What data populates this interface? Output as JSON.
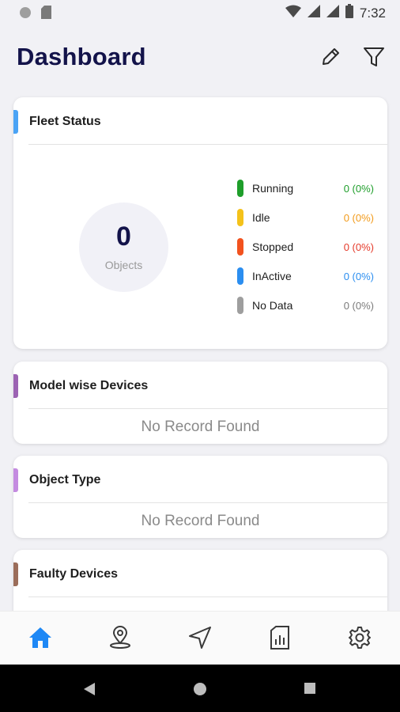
{
  "status_bar": {
    "time": "7:32",
    "icons": [
      "circle-icon",
      "sd-card-icon",
      "wifi-icon",
      "signal-icon",
      "signal-icon",
      "battery-icon"
    ]
  },
  "header": {
    "title": "Dashboard",
    "edit_icon": "pencil-icon",
    "filter_icon": "filter-icon"
  },
  "fleet_status": {
    "title": "Fleet Status",
    "accent": "#4aa3f5",
    "total_count": "0",
    "total_label": "Objects",
    "legend": [
      {
        "label": "Running",
        "value": "0 (0%)",
        "color": "#1e9e2a"
      },
      {
        "label": "Idle",
        "value": "0 (0%)",
        "color": "#f4c21a"
      },
      {
        "label": "Stopped",
        "value": "0 (0%)",
        "color": "#f2521e"
      },
      {
        "label": "InActive",
        "value": "0 (0%)",
        "color": "#2b8ef0"
      },
      {
        "label": "No Data",
        "value": "0 (0%)",
        "color": "#9e9e9e"
      }
    ]
  },
  "model_wise": {
    "title": "Model wise Devices",
    "accent": "#9c63b3",
    "empty_text": "No Record Found"
  },
  "object_type": {
    "title": "Object Type",
    "accent": "#c48be0",
    "empty_text": "No Record Found"
  },
  "faulty": {
    "title": "Faulty Devices",
    "accent": "#9b6d5a"
  },
  "bottom_nav": {
    "items": [
      "home-icon",
      "map-pin-icon",
      "navigation-icon",
      "report-icon",
      "settings-icon"
    ],
    "active_color": "#1e88f5",
    "inactive_color": "#3a3a3a"
  }
}
